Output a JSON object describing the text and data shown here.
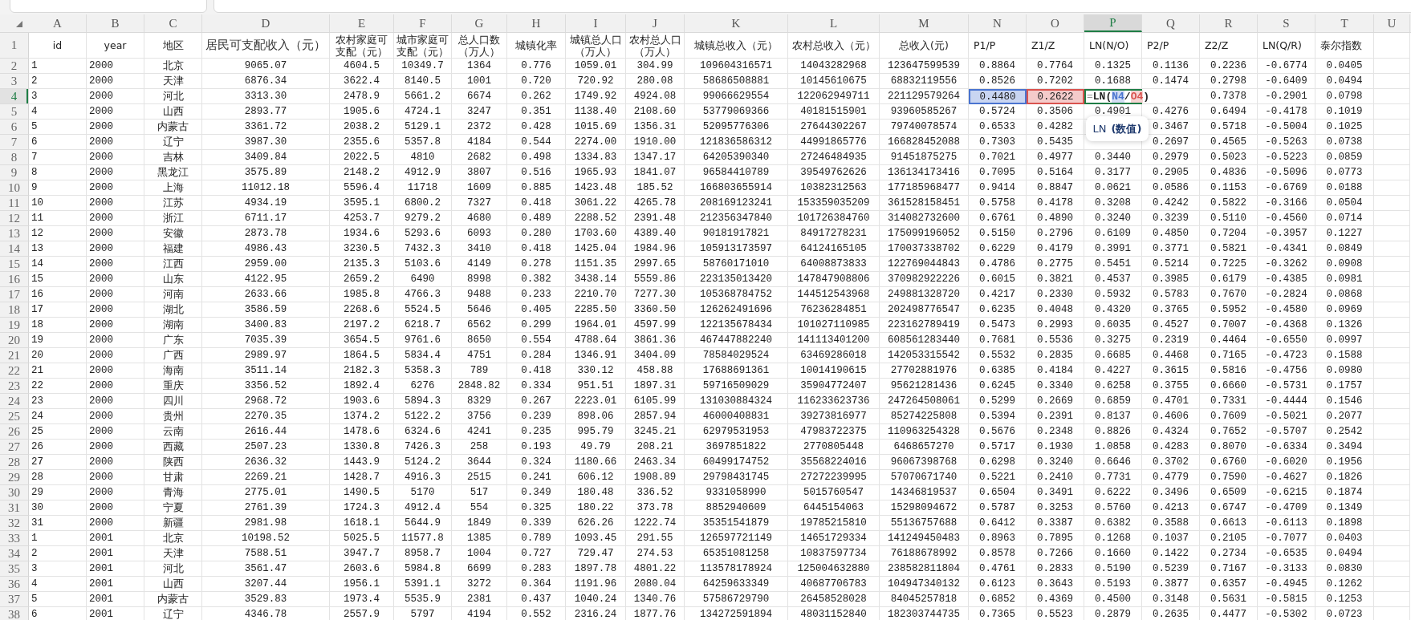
{
  "columns": [
    {
      "label": "A",
      "selected": false
    },
    {
      "label": "B",
      "selected": false
    },
    {
      "label": "C",
      "selected": false
    },
    {
      "label": "D",
      "selected": false
    },
    {
      "label": "E",
      "selected": false
    },
    {
      "label": "F",
      "selected": false
    },
    {
      "label": "G",
      "selected": false
    },
    {
      "label": "H",
      "selected": false
    },
    {
      "label": "I",
      "selected": false
    },
    {
      "label": "J",
      "selected": false
    },
    {
      "label": "K",
      "selected": false
    },
    {
      "label": "L",
      "selected": false
    },
    {
      "label": "M",
      "selected": false
    },
    {
      "label": "N",
      "selected": false
    },
    {
      "label": "O",
      "selected": false
    },
    {
      "label": "P",
      "selected": true
    },
    {
      "label": "Q",
      "selected": false
    },
    {
      "label": "R",
      "selected": false
    },
    {
      "label": "S",
      "selected": false
    },
    {
      "label": "T",
      "selected": false
    },
    {
      "label": "U",
      "selected": false
    }
  ],
  "header_row": {
    "number": "1",
    "selected": false,
    "cells": [
      "id",
      "year",
      "地区",
      "居民可支配收入（元）",
      "农村家庭可支配（元）",
      "城市家庭可支配（元）",
      "总人口数（万人）",
      "城镇化率",
      "城镇总人口（万人）",
      "农村总人口（万人）",
      "城镇总收入（元）",
      "农村总收入（元）",
      "总收入(元)",
      "P1/P",
      "Z1/Z",
      "LN(N/O)",
      "P2/P",
      "Z2/Z",
      "LN(Q/R)",
      "泰尔指数"
    ]
  },
  "rows": [
    {
      "number": "2",
      "selected": false,
      "cells": [
        "1",
        "2000",
        "北京",
        "9065.07",
        "4604.5",
        "10349.7",
        "1364",
        "0.776",
        "1059.01",
        "304.99",
        "109604316571",
        "14043282968",
        "123647599539",
        "0.8864",
        "0.7764",
        "0.1325",
        "0.1136",
        "0.2236",
        "-0.6774",
        "0.0405"
      ]
    },
    {
      "number": "3",
      "selected": false,
      "cells": [
        "2",
        "2000",
        "天津",
        "6876.34",
        "3622.4",
        "8140.5",
        "1001",
        "0.720",
        "720.92",
        "280.08",
        "58686508881",
        "10145610675",
        "68832119556",
        "0.8526",
        "0.7202",
        "0.1688",
        "0.1474",
        "0.2798",
        "-0.6409",
        "0.0494"
      ]
    },
    {
      "number": "4",
      "selected": true,
      "cells": [
        "3",
        "2000",
        "河北",
        "3313.30",
        "2478.9",
        "5661.2",
        "6674",
        "0.262",
        "1749.92",
        "4924.08",
        "99066629554",
        "122062949711",
        "221129579264",
        {
          "text": "0.4480",
          "color": "#4a74d0"
        },
        {
          "text": "0.2622",
          "color": "#d9534f"
        },
        {
          "kind": "formula",
          "parts": [
            {
              "text": "="
            },
            {
              "text": "LN("
            },
            {
              "text": "N4",
              "color": "#4a74d0"
            },
            {
              "text": "/"
            },
            {
              "text": "O4",
              "color": "#d9534f"
            },
            {
              "text": ")"
            }
          ]
        },
        null,
        "0.7378",
        "-0.2901",
        "0.0798"
      ]
    },
    {
      "number": "5",
      "selected": false,
      "cells": [
        "4",
        "2000",
        "山西",
        "2893.77",
        "1905.6",
        "4724.1",
        "3247",
        "0.351",
        "1138.40",
        "2108.60",
        "53779069366",
        "40181515901",
        "93960585267",
        "0.5724",
        "0.3506",
        "0.4901",
        "0.4276",
        "0.6494",
        "-0.4178",
        "0.1019"
      ]
    },
    {
      "number": "6",
      "selected": false,
      "cells": [
        "5",
        "2000",
        "内蒙古",
        "3361.72",
        "2038.2",
        "5129.1",
        "2372",
        "0.428",
        "1015.69",
        "1356.31",
        "52095776306",
        "27644302267",
        "79740078574",
        "0.6533",
        "0.4282",
        null,
        "0.3467",
        "0.5718",
        "-0.5004",
        "0.1025"
      ]
    },
    {
      "number": "7",
      "selected": false,
      "cells": [
        "6",
        "2000",
        "辽宁",
        "3987.30",
        "2355.6",
        "5357.8",
        "4184",
        "0.544",
        "2274.00",
        "1910.00",
        "121836586312",
        "44991865776",
        "166828452088",
        "0.7303",
        "0.5435",
        null,
        "0.2697",
        "0.4565",
        "-0.5263",
        "0.0738"
      ]
    },
    {
      "number": "8",
      "selected": false,
      "cells": [
        "7",
        "2000",
        "吉林",
        "3409.84",
        "2022.5",
        "4810",
        "2682",
        "0.498",
        "1334.83",
        "1347.17",
        "64205390340",
        "27246484935",
        "91451875275",
        "0.7021",
        "0.4977",
        "0.3440",
        "0.2979",
        "0.5023",
        "-0.5223",
        "0.0859"
      ]
    },
    {
      "number": "9",
      "selected": false,
      "cells": [
        "8",
        "2000",
        "黑龙江",
        "3575.89",
        "2148.2",
        "4912.9",
        "3807",
        "0.516",
        "1965.93",
        "1841.07",
        "96584410789",
        "39549762626",
        "136134173416",
        "0.7095",
        "0.5164",
        "0.3177",
        "0.2905",
        "0.4836",
        "-0.5096",
        "0.0773"
      ]
    },
    {
      "number": "10",
      "selected": false,
      "cells": [
        "9",
        "2000",
        "上海",
        "11012.18",
        "5596.4",
        "11718",
        "1609",
        "0.885",
        "1423.48",
        "185.52",
        "166803655914",
        "10382312563",
        "177185968477",
        "0.9414",
        "0.8847",
        "0.0621",
        "0.0586",
        "0.1153",
        "-0.6769",
        "0.0188"
      ]
    },
    {
      "number": "11",
      "selected": false,
      "cells": [
        "10",
        "2000",
        "江苏",
        "4934.19",
        "3595.1",
        "6800.2",
        "7327",
        "0.418",
        "3061.22",
        "4265.78",
        "208169123241",
        "153359035209",
        "361528158451",
        "0.5758",
        "0.4178",
        "0.3208",
        "0.4242",
        "0.5822",
        "-0.3166",
        "0.0504"
      ]
    },
    {
      "number": "12",
      "selected": false,
      "cells": [
        "11",
        "2000",
        "浙江",
        "6711.17",
        "4253.7",
        "9279.2",
        "4680",
        "0.489",
        "2288.52",
        "2391.48",
        "212356347840",
        "101726384760",
        "314082732600",
        "0.6761",
        "0.4890",
        "0.3240",
        "0.3239",
        "0.5110",
        "-0.4560",
        "0.0714"
      ]
    },
    {
      "number": "13",
      "selected": false,
      "cells": [
        "12",
        "2000",
        "安徽",
        "2873.78",
        "1934.6",
        "5293.6",
        "6093",
        "0.280",
        "1703.60",
        "4389.40",
        "90181917821",
        "84917278231",
        "175099196052",
        "0.5150",
        "0.2796",
        "0.6109",
        "0.4850",
        "0.7204",
        "-0.3957",
        "0.1227"
      ]
    },
    {
      "number": "14",
      "selected": false,
      "cells": [
        "13",
        "2000",
        "福建",
        "4986.43",
        "3230.5",
        "7432.3",
        "3410",
        "0.418",
        "1425.04",
        "1984.96",
        "105913173597",
        "64124165105",
        "170037338702",
        "0.6229",
        "0.4179",
        "0.3991",
        "0.3771",
        "0.5821",
        "-0.4341",
        "0.0849"
      ]
    },
    {
      "number": "15",
      "selected": false,
      "cells": [
        "14",
        "2000",
        "江西",
        "2959.00",
        "2135.3",
        "5103.6",
        "4149",
        "0.278",
        "1151.35",
        "2997.65",
        "58760171010",
        "64008873833",
        "122769044843",
        "0.4786",
        "0.2775",
        "0.5451",
        "0.5214",
        "0.7225",
        "-0.3262",
        "0.0908"
      ]
    },
    {
      "number": "16",
      "selected": false,
      "cells": [
        "15",
        "2000",
        "山东",
        "4122.95",
        "2659.2",
        "6490",
        "8998",
        "0.382",
        "3438.14",
        "5559.86",
        "223135013420",
        "147847908806",
        "370982922226",
        "0.6015",
        "0.3821",
        "0.4537",
        "0.3985",
        "0.6179",
        "-0.4385",
        "0.0981"
      ]
    },
    {
      "number": "17",
      "selected": false,
      "cells": [
        "16",
        "2000",
        "河南",
        "2633.66",
        "1985.8",
        "4766.3",
        "9488",
        "0.233",
        "2210.70",
        "7277.30",
        "105368784752",
        "144512543968",
        "249881328720",
        "0.4217",
        "0.2330",
        "0.5932",
        "0.5783",
        "0.7670",
        "-0.2824",
        "0.0868"
      ]
    },
    {
      "number": "18",
      "selected": false,
      "cells": [
        "17",
        "2000",
        "湖北",
        "3586.59",
        "2268.6",
        "5524.5",
        "5646",
        "0.405",
        "2285.50",
        "3360.50",
        "126262491696",
        "76236284851",
        "202498776547",
        "0.6235",
        "0.4048",
        "0.4320",
        "0.3765",
        "0.5952",
        "-0.4580",
        "0.0969"
      ]
    },
    {
      "number": "19",
      "selected": false,
      "cells": [
        "18",
        "2000",
        "湖南",
        "3400.83",
        "2197.2",
        "6218.7",
        "6562",
        "0.299",
        "1964.01",
        "4597.99",
        "122135678434",
        "101027110985",
        "223162789419",
        "0.5473",
        "0.2993",
        "0.6035",
        "0.4527",
        "0.7007",
        "-0.4368",
        "0.1326"
      ]
    },
    {
      "number": "20",
      "selected": false,
      "cells": [
        "19",
        "2000",
        "广东",
        "7035.39",
        "3654.5",
        "9761.6",
        "8650",
        "0.554",
        "4788.64",
        "3861.36",
        "467447882240",
        "141113401200",
        "608561283440",
        "0.7681",
        "0.5536",
        "0.3275",
        "0.2319",
        "0.4464",
        "-0.6550",
        "0.0997"
      ]
    },
    {
      "number": "21",
      "selected": false,
      "cells": [
        "20",
        "2000",
        "广西",
        "2989.97",
        "1864.5",
        "5834.4",
        "4751",
        "0.284",
        "1346.91",
        "3404.09",
        "78584029524",
        "63469286018",
        "142053315542",
        "0.5532",
        "0.2835",
        "0.6685",
        "0.4468",
        "0.7165",
        "-0.4723",
        "0.1588"
      ]
    },
    {
      "number": "22",
      "selected": false,
      "cells": [
        "21",
        "2000",
        "海南",
        "3511.14",
        "2182.3",
        "5358.3",
        "789",
        "0.418",
        "330.12",
        "458.88",
        "17688691361",
        "10014190615",
        "27702881976",
        "0.6385",
        "0.4184",
        "0.4227",
        "0.3615",
        "0.5816",
        "-0.4756",
        "0.0980"
      ]
    },
    {
      "number": "23",
      "selected": false,
      "cells": [
        "22",
        "2000",
        "重庆",
        "3356.52",
        "1892.4",
        "6276",
        "2848.82",
        "0.334",
        "951.51",
        "1897.31",
        "59716509029",
        "35904772407",
        "95621281436",
        "0.6245",
        "0.3340",
        "0.6258",
        "0.3755",
        "0.6660",
        "-0.5731",
        "0.1757"
      ]
    },
    {
      "number": "24",
      "selected": false,
      "cells": [
        "23",
        "2000",
        "四川",
        "2968.72",
        "1903.6",
        "5894.3",
        "8329",
        "0.267",
        "2223.01",
        "6105.99",
        "131030884324",
        "116233623736",
        "247264508061",
        "0.5299",
        "0.2669",
        "0.6859",
        "0.4701",
        "0.7331",
        "-0.4444",
        "0.1546"
      ]
    },
    {
      "number": "25",
      "selected": false,
      "cells": [
        "24",
        "2000",
        "贵州",
        "2270.35",
        "1374.2",
        "5122.2",
        "3756",
        "0.239",
        "898.06",
        "2857.94",
        "46000408831",
        "39273816977",
        "85274225808",
        "0.5394",
        "0.2391",
        "0.8137",
        "0.4606",
        "0.7609",
        "-0.5021",
        "0.2077"
      ]
    },
    {
      "number": "26",
      "selected": false,
      "cells": [
        "25",
        "2000",
        "云南",
        "2616.44",
        "1478.6",
        "6324.6",
        "4241",
        "0.235",
        "995.79",
        "3245.21",
        "62979531953",
        "47983722375",
        "110963254328",
        "0.5676",
        "0.2348",
        "0.8826",
        "0.4324",
        "0.7652",
        "-0.5707",
        "0.2542"
      ]
    },
    {
      "number": "27",
      "selected": false,
      "cells": [
        "26",
        "2000",
        "西藏",
        "2507.23",
        "1330.8",
        "7426.3",
        "258",
        "0.193",
        "49.79",
        "208.21",
        "3697851822",
        "2770805448",
        "6468657270",
        "0.5717",
        "0.1930",
        "1.0858",
        "0.4283",
        "0.8070",
        "-0.6334",
        "0.3494"
      ]
    },
    {
      "number": "28",
      "selected": false,
      "cells": [
        "27",
        "2000",
        "陕西",
        "2636.32",
        "1443.9",
        "5124.2",
        "3644",
        "0.324",
        "1180.66",
        "2463.34",
        "60499174752",
        "35568224016",
        "96067398768",
        "0.6298",
        "0.3240",
        "0.6646",
        "0.3702",
        "0.6760",
        "-0.6020",
        "0.1956"
      ]
    },
    {
      "number": "29",
      "selected": false,
      "cells": [
        "28",
        "2000",
        "甘肃",
        "2269.21",
        "1428.7",
        "4916.3",
        "2515",
        "0.241",
        "606.12",
        "1908.89",
        "29798431745",
        "27272239995",
        "57070671740",
        "0.5221",
        "0.2410",
        "0.7731",
        "0.4779",
        "0.7590",
        "-0.4627",
        "0.1826"
      ]
    },
    {
      "number": "30",
      "selected": false,
      "cells": [
        "29",
        "2000",
        "青海",
        "2775.01",
        "1490.5",
        "5170",
        "517",
        "0.349",
        "180.48",
        "336.52",
        "9331058990",
        "5015760547",
        "14346819537",
        "0.6504",
        "0.3491",
        "0.6222",
        "0.3496",
        "0.6509",
        "-0.6215",
        "0.1874"
      ]
    },
    {
      "number": "31",
      "selected": false,
      "cells": [
        "30",
        "2000",
        "宁夏",
        "2761.39",
        "1724.3",
        "4912.4",
        "554",
        "0.325",
        "180.22",
        "373.78",
        "8852940609",
        "6445154063",
        "15298094672",
        "0.5787",
        "0.3253",
        "0.5760",
        "0.4213",
        "0.6747",
        "-0.4709",
        "0.1349"
      ]
    },
    {
      "number": "32",
      "selected": false,
      "cells": [
        "31",
        "2000",
        "新疆",
        "2981.98",
        "1618.1",
        "5644.9",
        "1849",
        "0.339",
        "626.26",
        "1222.74",
        "35351541879",
        "19785215810",
        "55136757688",
        "0.6412",
        "0.3387",
        "0.6382",
        "0.3588",
        "0.6613",
        "-0.6113",
        "0.1898"
      ]
    },
    {
      "number": "33",
      "selected": false,
      "cells": [
        "1",
        "2001",
        "北京",
        "10198.52",
        "5025.5",
        "11577.8",
        "1385",
        "0.789",
        "1093.45",
        "291.55",
        "126597721149",
        "14651729334",
        "141249450483",
        "0.8963",
        "0.7895",
        "0.1268",
        "0.1037",
        "0.2105",
        "-0.7077",
        "0.0403"
      ]
    },
    {
      "number": "34",
      "selected": false,
      "cells": [
        "2",
        "2001",
        "天津",
        "7588.51",
        "3947.7",
        "8958.7",
        "1004",
        "0.727",
        "729.47",
        "274.53",
        "65351081258",
        "10837597734",
        "76188678992",
        "0.8578",
        "0.7266",
        "0.1660",
        "0.1422",
        "0.2734",
        "-0.6535",
        "0.0494"
      ]
    },
    {
      "number": "35",
      "selected": false,
      "cells": [
        "3",
        "2001",
        "河北",
        "3561.47",
        "2603.6",
        "5984.8",
        "6699",
        "0.283",
        "1897.78",
        "4801.22",
        "113578178924",
        "125004632880",
        "238582811804",
        "0.4761",
        "0.2833",
        "0.5190",
        "0.5239",
        "0.7167",
        "-0.3133",
        "0.0830"
      ]
    },
    {
      "number": "36",
      "selected": false,
      "cells": [
        "4",
        "2001",
        "山西",
        "3207.44",
        "1956.1",
        "5391.1",
        "3272",
        "0.364",
        "1191.96",
        "2080.04",
        "64259633349",
        "40687706783",
        "104947340132",
        "0.6123",
        "0.3643",
        "0.5193",
        "0.3877",
        "0.6357",
        "-0.4945",
        "0.1262"
      ]
    },
    {
      "number": "37",
      "selected": false,
      "cells": [
        "5",
        "2001",
        "内蒙古",
        "3529.83",
        "1973.4",
        "5535.9",
        "2381",
        "0.437",
        "1040.24",
        "1340.76",
        "57586729790",
        "26458528028",
        "84045257818",
        "0.6852",
        "0.4369",
        "0.4500",
        "0.3148",
        "0.5631",
        "-0.5815",
        "0.1253"
      ]
    },
    {
      "number": "38",
      "selected": false,
      "cells": [
        "6",
        "2001",
        "辽宁",
        "4346.78",
        "2557.9",
        "5797",
        "4194",
        "0.552",
        "2316.24",
        "1877.76",
        "134272591894",
        "48031152840",
        "182303744735",
        "0.7365",
        "0.5523",
        "0.2879",
        "0.2635",
        "0.4477",
        "-0.5302",
        "0.0723"
      ]
    }
  ],
  "tooltip": {
    "function": "LN",
    "argument": "(数值)"
  }
}
